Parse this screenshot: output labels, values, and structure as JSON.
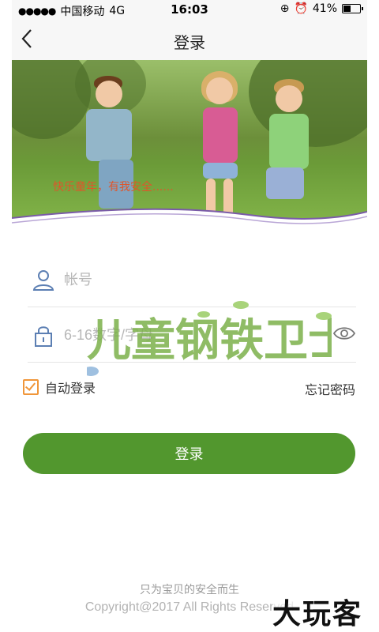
{
  "status_bar": {
    "carrier": "中国移动",
    "network": "4G",
    "time": "16:03",
    "battery": "41%"
  },
  "nav": {
    "title": "登录"
  },
  "hero": {
    "slogan": "快乐童年，有我安全......"
  },
  "watermark": {
    "text": "儿童钢铁卫士"
  },
  "form": {
    "account_placeholder": "帐号",
    "password_placeholder": "6-16数字/字母",
    "remember_label": "自动登录",
    "forgot_label": "忘记密码",
    "login_label": "登录"
  },
  "footer": {
    "tagline": "只为宝贝的安全而生",
    "copyright": "Copyright@2017 All Rights Reserved"
  },
  "corner_watermark": "大玩客",
  "colors": {
    "accent_green": "#52972e",
    "checkbox_orange": "#f0963a",
    "slogan_orange": "#e0552a"
  }
}
